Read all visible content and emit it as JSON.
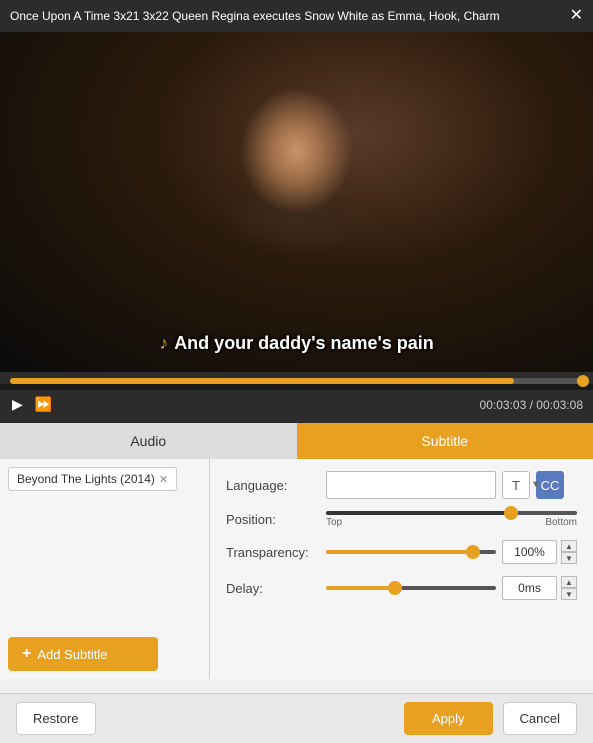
{
  "titleBar": {
    "title": "Once Upon A Time 3x21 3x22 Queen Regina executes Snow White as Emma, Hook, Charm",
    "closeLabel": "✕"
  },
  "video": {
    "subtitleNote": "♪",
    "subtitleText": "And your daddy's name's pain"
  },
  "player": {
    "currentTime": "00:03:03",
    "totalTime": "00:03:08",
    "progressPercent": 88,
    "playIcon": "▶",
    "fastForwardIcon": "⏩"
  },
  "tabs": {
    "audio": "Audio",
    "subtitle": "Subtitle"
  },
  "audio": {
    "tag": "Beyond The Lights (2014)",
    "tagCloseLabel": "✕",
    "addSubtitleLabel": "Add Subtitle",
    "addIcon": "+"
  },
  "subtitle": {
    "languageLabel": "Language:",
    "languagePlaceholder": "",
    "positionLabel": "Position:",
    "positionTopLabel": "Top",
    "positionBottomLabel": "Bottom",
    "transparencyLabel": "Transparency:",
    "transparencyValue": "100%",
    "delayLabel": "Delay:",
    "delayValue": "0ms",
    "textIcon": "T",
    "ccIcon": "CC"
  },
  "bottomBar": {
    "restoreLabel": "Restore",
    "applyLabel": "Apply",
    "cancelLabel": "Cancel"
  }
}
